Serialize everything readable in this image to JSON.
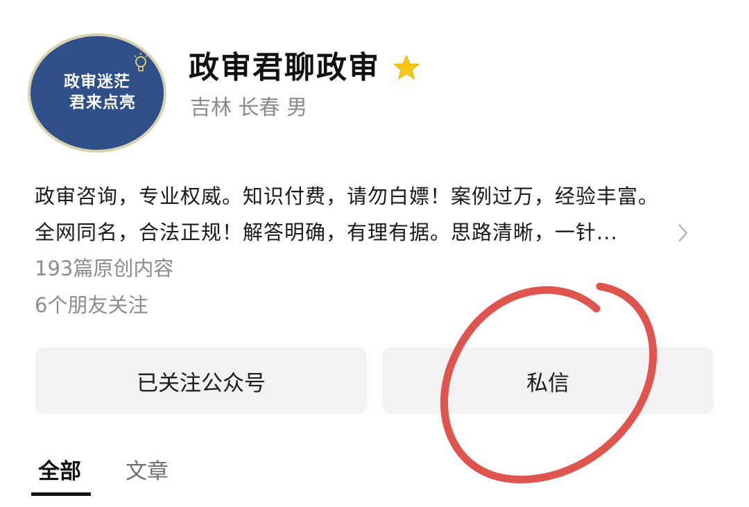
{
  "profile": {
    "avatar_line1": "政审迷茫",
    "avatar_line2": "君来点亮",
    "name": "政审君聊政审",
    "location": "吉林 长春 男",
    "description_line1": "政审咨询，专业权威。知识付费，请勿白嫖！案例过万，经验丰富。",
    "description_line2": "全网同名，合法正规！解答明确，有理有据。思路清晰，一针...",
    "original_count": "193篇原创内容",
    "friends_following": "6个朋友关注"
  },
  "actions": {
    "follow_label": "已关注公众号",
    "message_label": "私信"
  },
  "tabs": [
    {
      "label": "全部",
      "active": true
    },
    {
      "label": "文章",
      "active": false
    }
  ],
  "colors": {
    "avatar_bg": "#2f4f88",
    "star": "#f5c518",
    "annotation": "#e0544e",
    "button_bg": "#f2f2f2"
  },
  "icons": {
    "star": "star-icon",
    "chevron": "chevron-right-icon",
    "bulb": "lightbulb-icon"
  }
}
